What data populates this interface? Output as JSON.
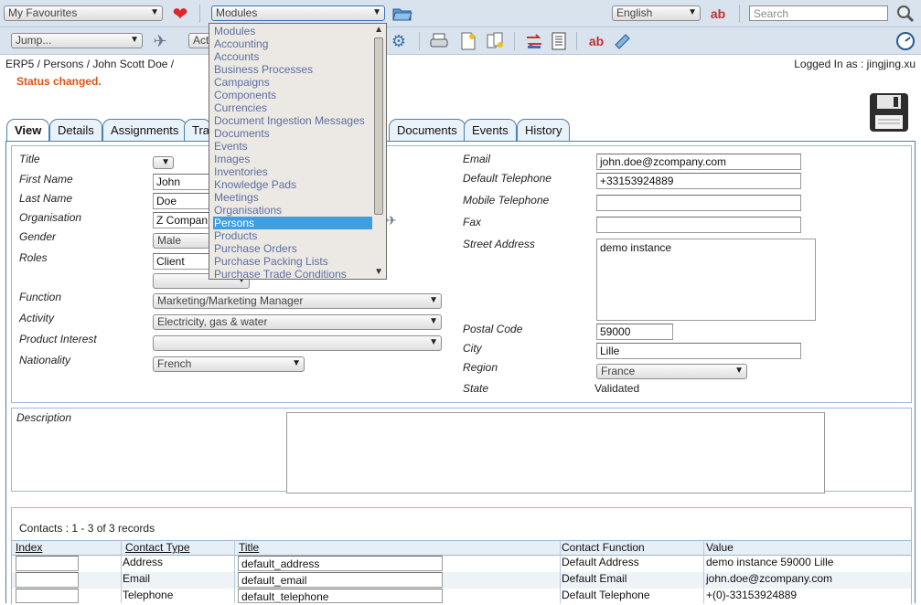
{
  "toolbar": {
    "favourites_value": "My Favourites",
    "modules_value": "Modules",
    "language_value": "English",
    "search_placeholder": "Search",
    "jump_value": "Jump...",
    "action_value": "Act"
  },
  "dropdown": {
    "items": [
      "Modules",
      "Accounting",
      "Accounts",
      "Business Processes",
      "Campaigns",
      "Components",
      "Currencies",
      "Document Ingestion Messages",
      "Documents",
      "Events",
      "Images",
      "Inventories",
      "Knowledge Pads",
      "Meetings",
      "Organisations",
      "Persons",
      "Products",
      "Purchase Orders",
      "Purchase Packing Lists",
      "Purchase Trade Conditions"
    ],
    "selected": "Persons"
  },
  "breadcrumb": {
    "text": "ERP5 / Persons / John Scott Doe /"
  },
  "login": {
    "text": "Logged In as : jingjing.xu"
  },
  "status": {
    "message": "Status changed."
  },
  "tabs": [
    "View",
    "Details",
    "Assignments",
    "Tra",
    "Documents",
    "Events",
    "History"
  ],
  "form_left": {
    "title_label": "Title",
    "title_value": "",
    "first_name_label": "First Name",
    "first_name_value": "John",
    "last_name_label": "Last Name",
    "last_name_value": "Doe",
    "organisation_label": "Organisation",
    "organisation_value": "Z Compan",
    "gender_label": "Gender",
    "gender_value": "Male",
    "roles_label": "Roles",
    "roles_value": "Client",
    "roles_value2": "",
    "function_label": "Function",
    "function_value": "Marketing/Marketing Manager",
    "activity_label": "Activity",
    "activity_value": "Electricity, gas & water",
    "product_interest_label": "Product Interest",
    "product_interest_value": "",
    "nationality_label": "Nationality",
    "nationality_value": "French"
  },
  "form_right": {
    "email_label": "Email",
    "email_value": "john.doe@zcompany.com",
    "telephone_label": "Default Telephone",
    "telephone_value": "+33153924889",
    "mobile_label": "Mobile Telephone",
    "mobile_value": "",
    "fax_label": "Fax",
    "fax_value": "",
    "street_label": "Street Address",
    "street_value": "demo instance",
    "postal_label": "Postal Code",
    "postal_value": "59000",
    "city_label": "City",
    "city_value": "Lille",
    "region_label": "Region",
    "region_value": "France",
    "state_label": "State",
    "state_value": "Validated"
  },
  "description": {
    "label": "Description",
    "value": ""
  },
  "contacts": {
    "caption": "Contacts : 1 - 3 of 3 records",
    "headers": [
      "Index",
      "Contact Type",
      "Title",
      "Contact Function",
      "Value"
    ],
    "rows": [
      {
        "index": "",
        "type": "Address",
        "title": "default_address",
        "function": "Default Address",
        "value": "demo instance 59000 Lille"
      },
      {
        "index": "",
        "type": "Email",
        "title": "default_email",
        "function": "Default Email",
        "value": "john.doe@zcompany.com"
      },
      {
        "index": "",
        "type": "Telephone",
        "title": "default_telephone",
        "function": "Default Telephone",
        "value": "+(0)-33153924889"
      }
    ]
  },
  "colors": {
    "accent": "#4f7fa6",
    "status": "#e05414",
    "selected": "#3e9ee0",
    "bar": "#d8e3ee"
  }
}
